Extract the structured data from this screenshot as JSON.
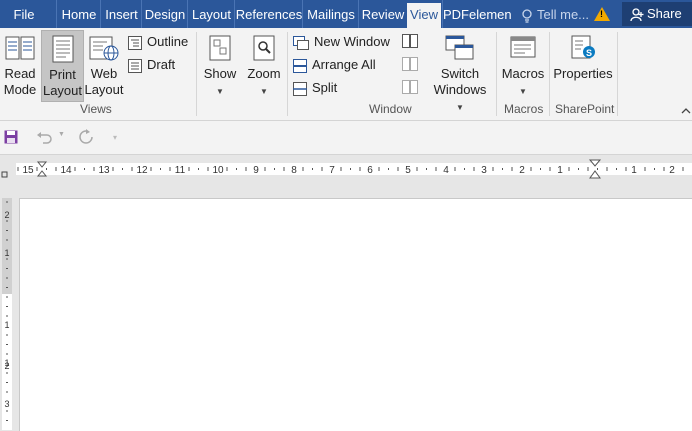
{
  "tabs": [
    {
      "label": "File"
    },
    {
      "label": "Home"
    },
    {
      "label": "Insert"
    },
    {
      "label": "Design"
    },
    {
      "label": "Layout"
    },
    {
      "label": "References"
    },
    {
      "label": "Mailings"
    },
    {
      "label": "Review"
    },
    {
      "label": "View",
      "active": true
    },
    {
      "label": "PDFelemen"
    }
  ],
  "tell_me": "Tell me...",
  "share_label": "Share",
  "ribbon": {
    "views": {
      "read_mode": [
        "Read",
        "Mode"
      ],
      "print_layout": [
        "Print",
        "Layout"
      ],
      "web_layout": [
        "Web",
        "Layout"
      ],
      "outline": "Outline",
      "draft": "Draft",
      "group_label": "Views"
    },
    "show": "Show",
    "zoom": "Zoom",
    "window": {
      "new_window": "New Window",
      "arrange_all": "Arrange All",
      "split": "Split",
      "switch_windows": [
        "Switch",
        "Windows"
      ],
      "group_label": "Window"
    },
    "macros": {
      "label": "Macros",
      "group_label": "Macros"
    },
    "sharepoint": {
      "label": "Properties",
      "group_label": "SharePoint"
    }
  },
  "ruler": {
    "h_labels": [
      "15",
      "14",
      "13",
      "12",
      "11",
      "10",
      "9",
      "8",
      "7",
      "6",
      "5",
      "4",
      "3",
      "2",
      "1",
      "1",
      "2"
    ],
    "v_labels": [
      "2",
      "1",
      "1",
      "1",
      "2",
      "3"
    ]
  },
  "colors": {
    "accent": "#2b579a",
    "share_bg": "#1e3f73",
    "warning": "#f2a900"
  }
}
